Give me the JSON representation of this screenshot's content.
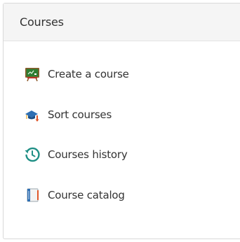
{
  "panel": {
    "title": "Courses"
  },
  "menu": {
    "items": [
      {
        "label": "Create a course",
        "icon": "chalkboard-icon"
      },
      {
        "label": "Sort courses",
        "icon": "sort-courses-icon"
      },
      {
        "label": "Courses history",
        "icon": "history-icon"
      },
      {
        "label": "Course catalog",
        "icon": "catalog-book-icon"
      }
    ]
  },
  "colors": {
    "text": "#333333",
    "header_bg": "#f5f5f5",
    "border": "#d9d9d9",
    "chalkboard_green": "#2e7d32",
    "chalkboard_frame": "#8d5a2b",
    "history_teal": "#1f8f85",
    "sort_blue": "#2f6fb3",
    "sort_red": "#e0572a"
  }
}
